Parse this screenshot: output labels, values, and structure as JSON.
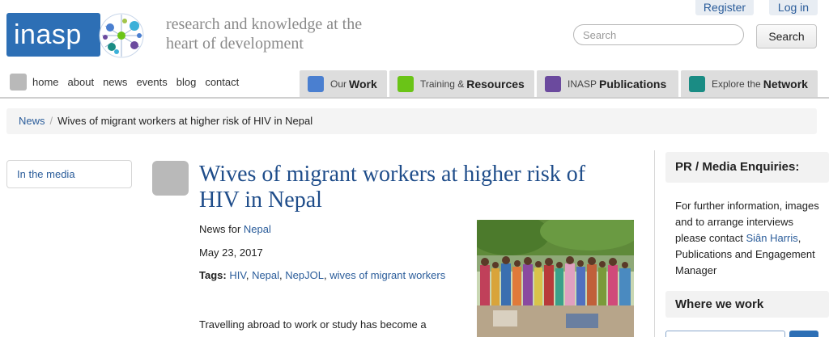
{
  "header": {
    "logo_text": "inasp",
    "tagline_line1": "research and knowledge at the",
    "tagline_line2": "heart of development",
    "register_label": "Register",
    "login_label": "Log in",
    "search_placeholder": "Search",
    "search_button": "Search"
  },
  "nav": {
    "links": [
      "home",
      "about",
      "news",
      "events",
      "blog",
      "contact"
    ],
    "tabs": [
      {
        "small": "Our",
        "big": "Work",
        "color": "#4a7fd0"
      },
      {
        "small": "Training &",
        "big": "Resources",
        "color": "#6ac417"
      },
      {
        "small": "INASP",
        "big": "Publications",
        "color": "#6b4a9e"
      },
      {
        "small": "Explore the",
        "big": "Network",
        "color": "#1a8c84"
      }
    ]
  },
  "breadcrumb": {
    "parent": "News",
    "separator": "/",
    "current": "Wives of migrant workers at higher risk of HIV in Nepal"
  },
  "sidebar_left": {
    "item": "In the media"
  },
  "article": {
    "title_line1": "Wives of migrant workers at higher risk of",
    "title_line2": "HIV in Nepal",
    "news_for_label": "News for",
    "news_for_country": "Nepal",
    "date": "May 23, 2017",
    "tags_label": "Tags:",
    "tags": [
      "HIV",
      "Nepal",
      "NepJOL",
      "wives of migrant workers"
    ],
    "body_line1": "Travelling abroad to work or study has become a"
  },
  "sidebar_right": {
    "pr_heading": "PR / Media Enquiries:",
    "pr_text_1": "For further information, images and to arrange interviews please contact",
    "pr_contact": "Siân Harris",
    "pr_text_2": ", Publications and Engagement Manager",
    "where_heading": "Where we work"
  },
  "colors": {
    "brand_blue": "#2d6fb5",
    "link": "#2a5c9a",
    "title": "#1f4d8a"
  }
}
